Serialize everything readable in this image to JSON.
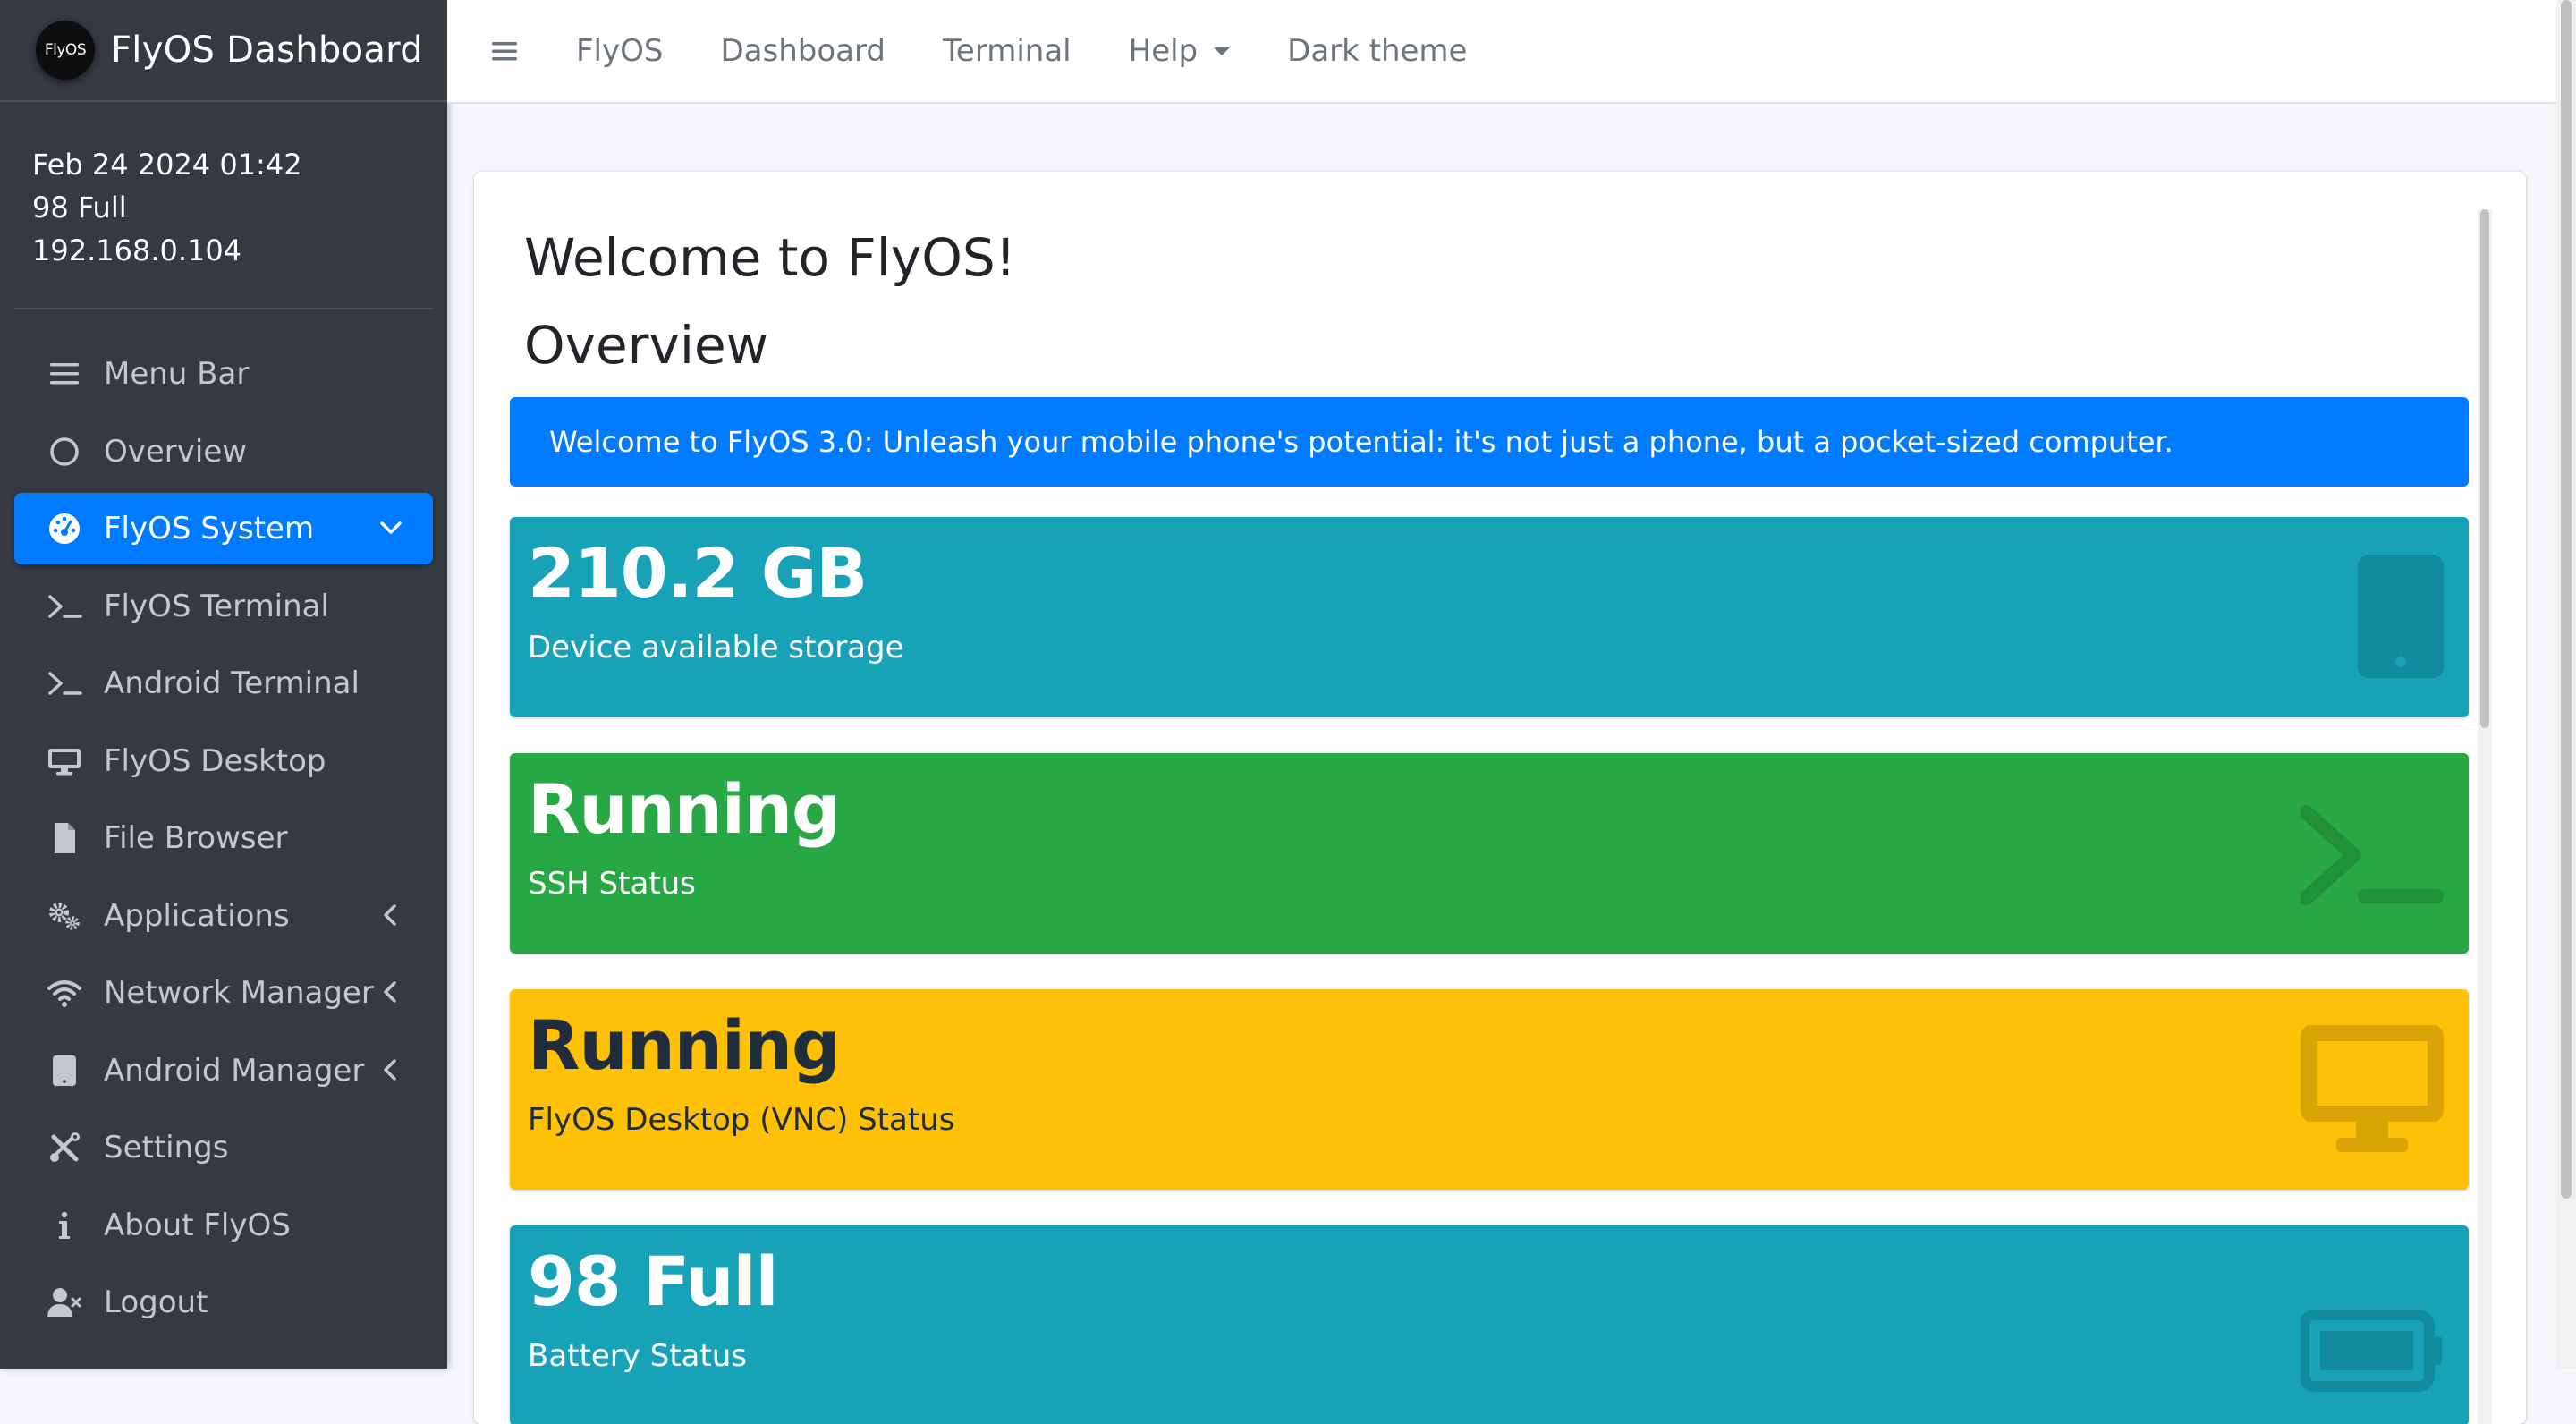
{
  "brand": {
    "logo_text": "FlyOS",
    "title": "FlyOS Dashboard"
  },
  "user_panel": {
    "datetime": "Feb 24 2024 01:42",
    "battery": "98 Full",
    "ip": "192.168.0.104"
  },
  "sidebar": {
    "items": [
      {
        "label": "Menu Bar",
        "icon": "bars-icon",
        "active": false,
        "arrow": null
      },
      {
        "label": "Overview",
        "icon": "circle-icon",
        "active": false,
        "arrow": null
      },
      {
        "label": "FlyOS System",
        "icon": "dashboard-gauge-icon",
        "active": true,
        "arrow": "down"
      },
      {
        "label": "FlyOS Terminal",
        "icon": "terminal-icon",
        "active": false,
        "arrow": null
      },
      {
        "label": "Android Terminal",
        "icon": "terminal-icon",
        "active": false,
        "arrow": null
      },
      {
        "label": "FlyOS Desktop",
        "icon": "desktop-icon",
        "active": false,
        "arrow": null
      },
      {
        "label": "File Browser",
        "icon": "file-icon",
        "active": false,
        "arrow": null
      },
      {
        "label": "Applications",
        "icon": "cogs-icon",
        "active": false,
        "arrow": "left"
      },
      {
        "label": "Network Manager",
        "icon": "wifi-icon",
        "active": false,
        "arrow": "left"
      },
      {
        "label": "Android Manager",
        "icon": "tablet-icon",
        "active": false,
        "arrow": "left"
      },
      {
        "label": "Settings",
        "icon": "tools-icon",
        "active": false,
        "arrow": null
      },
      {
        "label": "About FlyOS",
        "icon": "info-icon",
        "active": false,
        "arrow": null
      },
      {
        "label": "Logout",
        "icon": "user-times-icon",
        "active": false,
        "arrow": null
      }
    ]
  },
  "topnav": {
    "links": [
      "FlyOS",
      "Dashboard",
      "Terminal",
      "Help",
      "Dark theme"
    ]
  },
  "main": {
    "welcome_title": "Welcome to FlyOS!",
    "overview_title": "Overview",
    "alert": "Welcome to FlyOS 3.0: Unleash your mobile phone's potential: it's not just a phone, but a pocket-sized computer.",
    "boxes": [
      {
        "value": "210.2 GB",
        "label": "Device available storage",
        "icon": "mobile-icon",
        "color": "#17a2b8"
      },
      {
        "value": "Running",
        "label": "SSH Status",
        "icon": "terminal-icon",
        "color": "#28a745"
      },
      {
        "value": "Running",
        "label": "FlyOS Desktop (VNC) Status",
        "icon": "desktop-icon",
        "color": "#ffc107"
      },
      {
        "value": "98 Full",
        "label": "Battery Status",
        "icon": "battery-icon",
        "color": "#17a2b8"
      }
    ]
  },
  "colors": {
    "sidebar_bg": "#343a40",
    "accent": "#007bff",
    "teal": "#17a2b8",
    "green": "#28a745",
    "yellow": "#ffc107"
  }
}
